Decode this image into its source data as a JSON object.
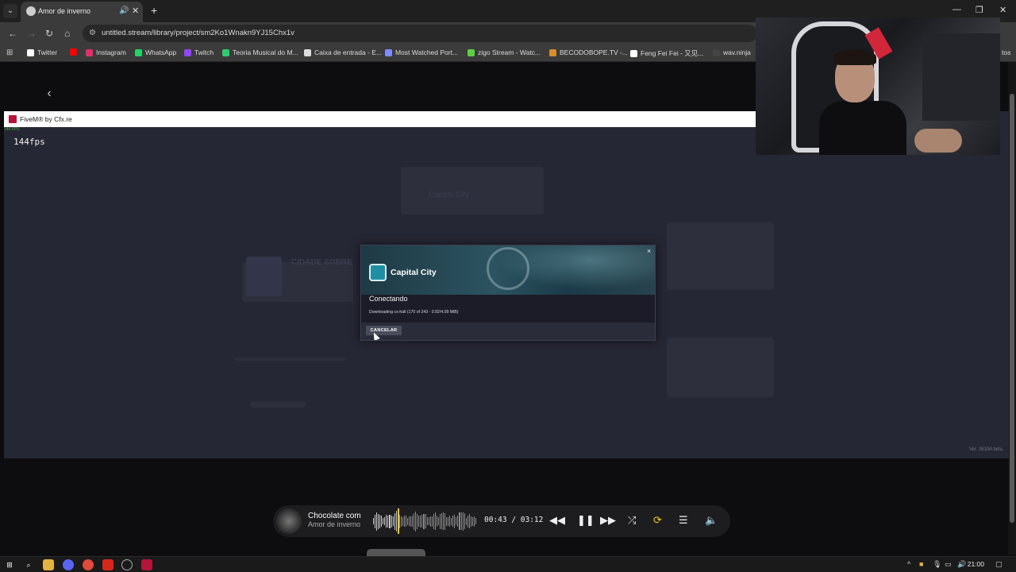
{
  "browser": {
    "tab_title": "Amor de inverno",
    "url": "untitled.stream/library/project/sm2Ko1Wnakn9YJ15Chx1v",
    "bookmarks": [
      {
        "label": "Twitter",
        "icon": "x-icon",
        "color": "#ffffff"
      },
      {
        "label": "",
        "icon": "youtube-icon",
        "color": "#ff0000"
      },
      {
        "label": "Instagram",
        "icon": "instagram-icon",
        "color": "#e1306c"
      },
      {
        "label": "WhatsApp",
        "icon": "whatsapp-icon",
        "color": "#25d366"
      },
      {
        "label": "Twitch",
        "icon": "twitch-icon",
        "color": "#9146ff"
      },
      {
        "label": "Teoria Musical do M...",
        "icon": "music-theory-icon",
        "color": "#2ecc71"
      },
      {
        "label": "Caixa de entrada - E...",
        "icon": "mail-icon",
        "color": "#dddddd"
      },
      {
        "label": "Most Watched Port...",
        "icon": "chart-icon",
        "color": "#7f8cff"
      },
      {
        "label": "zigo Stream - Watc...",
        "icon": "zigo-icon",
        "color": "#5bd13f"
      },
      {
        "label": "BECODOBOPE.TV -...",
        "icon": "becodobope-icon",
        "color": "#d98c2b"
      },
      {
        "label": "Feng Fei Fei - 又见...",
        "icon": "s-icon",
        "color": "#ffffff"
      },
      {
        "label": "wav.ninja",
        "icon": "wav-icon",
        "color": "#444444"
      }
    ],
    "bookmarks_overflow": "tos"
  },
  "fivem": {
    "window_title": "FiveM® by Cfx.re",
    "fps_small": "144 FPS",
    "fps": "144fps",
    "version": "Ver. 26194.beta",
    "background_labels": [
      "CIDADE SOBRE",
      "Capital City"
    ]
  },
  "dialog": {
    "server_name": "Capital City",
    "status": "Conectando",
    "progress": "Downloading cs-hall (170 of 243 - 0.92/4.09 MiB)",
    "cancel_label": "CANCELAR",
    "close_glyph": "×"
  },
  "player": {
    "song_title": "Chocolate com",
    "artist": "Amor de inverno",
    "time_current": "00:43",
    "time_total": "03:12",
    "time_display": "00:43 / 03:12",
    "progress_fraction": 0.224
  },
  "taskbar": {
    "time": "21:00"
  },
  "colors": {
    "accent_yellow": "#f2cc17",
    "fivem_red": "#b3153b",
    "dialog_teal": "#1f8fa3"
  }
}
